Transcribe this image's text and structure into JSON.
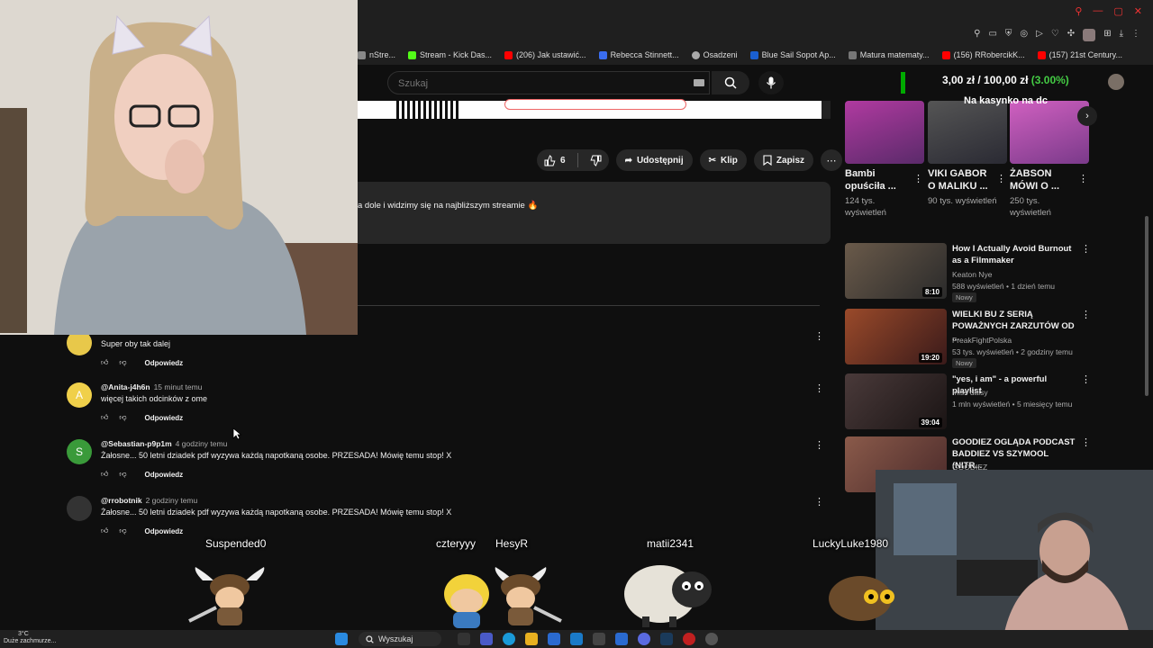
{
  "browser": {
    "bookmarks": [
      {
        "label": "nStre...",
        "color": "#888"
      },
      {
        "label": "Stream - Kick Das...",
        "color": "#53fc18"
      },
      {
        "label": "(206) Jak ustawić...",
        "color": "#ff0000"
      },
      {
        "label": "Rebecca Stinnett...",
        "color": "#3a6df0"
      },
      {
        "label": "Osadzeni",
        "color": "#aaaaaa"
      },
      {
        "label": "Blue Sail Sopot Ap...",
        "color": "#1a5fd0"
      },
      {
        "label": "Matura matematy...",
        "color": "#777"
      },
      {
        "label": "(156) RRobercikK...",
        "color": "#ff0000"
      },
      {
        "label": "(157) 21st Century...",
        "color": "#ff0000"
      }
    ]
  },
  "header": {
    "search_placeholder": "Szukaj",
    "donation_amount": "3,00 zł",
    "donation_sep": " / ",
    "donation_goal": "100,00 zł",
    "donation_pct": "(3.00%)"
  },
  "video": {
    "like_count": "6",
    "share_label": "Udostępnij",
    "clip_label": "Klip",
    "save_label": "Zapisz",
    "description": "a dole i widzimy się na najbliższym streamie 🔥"
  },
  "comments": [
    {
      "author": "",
      "time": "",
      "text": "Super oby tak dalej",
      "reply": "Odpowiedz",
      "avatar_color": "#e8c84a",
      "avatar_letter": ""
    },
    {
      "author": "@Anita-j4h6n",
      "time": "15 minut temu",
      "text": "więcej takich odcinków z ome",
      "reply": "Odpowiedz",
      "avatar_color": "#f0d04a",
      "avatar_letter": "A"
    },
    {
      "author": "@Sebastian-p9p1m",
      "time": "4 godziny temu",
      "text": "Żałosne... 50 letni dziadek pdf wyzywa każdą napotkaną osobe. PRZESADA! Mówię temu stop! X",
      "reply": "Odpowiedz",
      "avatar_color": "#3a9a3a",
      "avatar_letter": "S"
    },
    {
      "author": "@rrobotnik",
      "time": "2 godziny temu",
      "text": "Żałosne... 50 letni dziadek pdf wyzywa każdą napotkaną osobe. PRZESADA! Mówię temu stop! X",
      "reply": "Odpowiedz",
      "avatar_color": "#333333",
      "avatar_letter": ""
    }
  ],
  "sidebar": {
    "shorts_overlay": "Na kasynko na dc",
    "shorts": [
      {
        "title": "Bambi opuściła ...",
        "views": "124 tys. wyświetleń",
        "color": "#8a2a8a"
      },
      {
        "title": "VIKI GABOR O MALIKU ...",
        "views": "90 tys. wyświetleń",
        "color": "#5a5a6a"
      },
      {
        "title": "ŻABSON MÓWI O ...",
        "views": "250 tys. wyświetleń",
        "color": "#b04aa0"
      }
    ],
    "recommended": [
      {
        "title": "How I Actually Avoid Burnout as a Filmmaker",
        "channel": "Keaton Nye",
        "meta": "588 wyświetleń • 1 dzień temu",
        "badge": "Nowy",
        "duration": "8:10",
        "color": "#6a5a4a"
      },
      {
        "title": "WIELKI BU Z SERIĄ POWAŻNYCH ZARZUTÓW OD ...",
        "channel": "FreakFightPolska",
        "meta": "53 tys. wyświetleń • 2 godziny temu",
        "badge": "Nowy",
        "duration": "19:20",
        "color": "#8a3a2a"
      },
      {
        "title": "\"yes, i am\" - a powerful playlist",
        "channel": "miss daisy",
        "meta": "1 mln wyświetleń • 5 miesięcy temu",
        "badge": "",
        "duration": "39:04",
        "color": "#3a3030"
      },
      {
        "title": "GOODIEZ OGLĄDA PODCAST BADDIEZ VS SZYMOOL (NITR...",
        "channel": "GOODIEZ",
        "meta": "",
        "badge": "",
        "duration": "",
        "color": "#7a4a3a"
      }
    ]
  },
  "overlay": {
    "names": [
      "Suspended0",
      "czteryyy",
      "HesyR",
      "matii2341",
      "LuckyLuke1980"
    ]
  },
  "taskbar": {
    "temp": "3°C",
    "weather": "Duże zachmurze...",
    "search": "Wyszukaj"
  }
}
